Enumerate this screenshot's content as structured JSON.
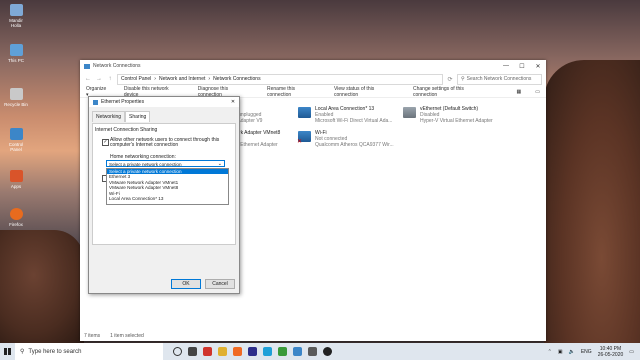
{
  "desktop": {
    "icons": [
      {
        "label": "Mandir Holla",
        "color": "#7fa9d6"
      },
      {
        "label": "This PC",
        "color": "#5fa0d8"
      },
      {
        "label": "Recycle Bin",
        "color": "#c9c9c9"
      },
      {
        "label": "Control Panel",
        "color": "#3c86c8"
      },
      {
        "label": "Apps",
        "color": "#d9542a"
      },
      {
        "label": "Firefox",
        "color": "#e86b1e"
      }
    ]
  },
  "explorer": {
    "title": "Network Connections",
    "breadcrumb": [
      "Control Panel",
      "Network and Internet",
      "Network Connections"
    ],
    "search_placeholder": "Search Network Connections",
    "commands": [
      "Organize ▾",
      "Disable this network device",
      "Diagnose this connection",
      "Rename this connection",
      "View status of this connection",
      "Change settings of this connection"
    ],
    "adapters": [
      {
        "name": "Ethernet 3",
        "status": "Network cable unplugged",
        "device": "TAP-Windows Adapter V9"
      },
      {
        "name": "Local Area Connection* 13",
        "status": "Enabled",
        "device": "Microsoft Wi-Fi Direct Virtual Ada..."
      },
      {
        "name": "vEthernet (Default Switch)",
        "status": "Disabled",
        "device": "Hyper-V Virtual Ethernet Adapter"
      },
      {
        "name": "VMware Network Adapter VMnet8",
        "status": "Enabled",
        "device": "VMware Virtual Ethernet Adapter"
      },
      {
        "name": "Wi-Fi",
        "status": "Not connected",
        "device": "Qualcomm Atheros QCA9377 Wir..."
      }
    ],
    "status": {
      "items": "7 items",
      "selected": "1 item selected"
    }
  },
  "dialog": {
    "title": "Ethernet Properties",
    "tabs": [
      "Networking",
      "Sharing"
    ],
    "group_label": "Internet Connection Sharing",
    "allow_label": "Allow other network users to connect through this computer's Internet connection",
    "home_label": "Home networking connection:",
    "select_value": "Select a private network connection",
    "options": [
      "Select a private network connection",
      "Ethernet 3",
      "VMware Network Adapter VMnet1",
      "VMware Network Adapter VMnet8",
      "Wi-Fi",
      "Local Area Connection* 13"
    ],
    "ok_label": "OK",
    "cancel_label": "Cancel"
  },
  "taskbar": {
    "search_placeholder": "Type here to search",
    "lang": "ENG",
    "time": "10:40 PM",
    "date": "26-05-2020"
  }
}
